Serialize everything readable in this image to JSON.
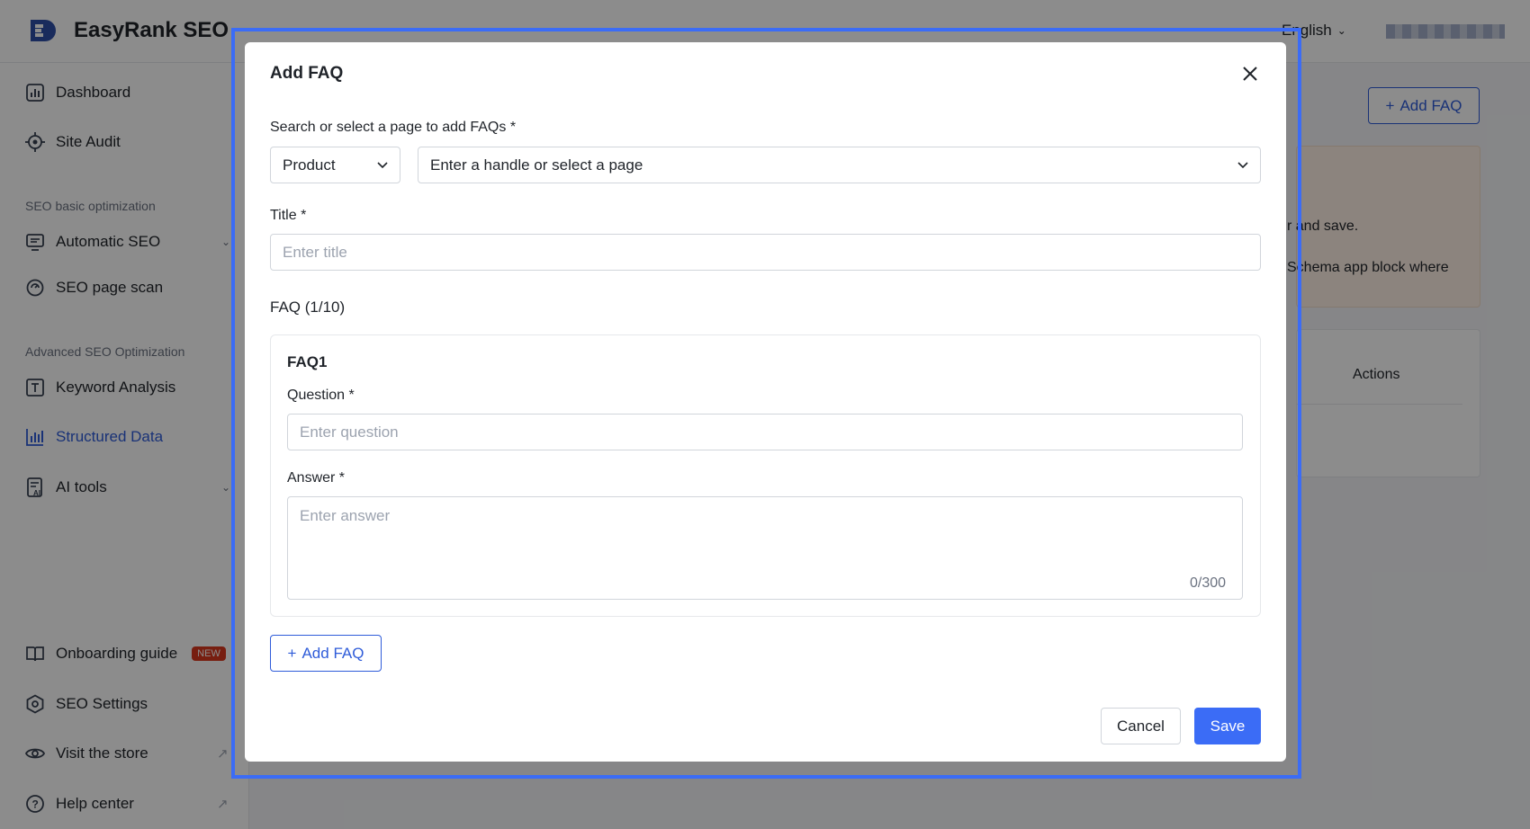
{
  "app": {
    "name": "EasyRank SEO",
    "language": "English",
    "colors": {
      "accent": "#2f5cd9",
      "primary_button": "#3b6cf6",
      "highlight_border": "#3b6cf6",
      "new_badge": "#d9381e"
    }
  },
  "sidebar": {
    "top_items": [
      {
        "label": "Dashboard",
        "icon": "dashboard-icon"
      },
      {
        "label": "Site Audit",
        "icon": "target-icon"
      }
    ],
    "section_basic": "SEO basic optimization",
    "basic_items": [
      {
        "label": "Automatic SEO",
        "icon": "monitor-icon",
        "expandable": true
      },
      {
        "label": "SEO page scan",
        "icon": "scan-icon"
      }
    ],
    "section_advanced": "Advanced SEO Optimization",
    "advanced_items": [
      {
        "label": "Keyword Analysis",
        "icon": "text-box-icon"
      },
      {
        "label": "Structured Data",
        "icon": "chart-bars-icon",
        "active": true
      },
      {
        "label": "AI tools",
        "icon": "ai-doc-icon",
        "expandable": true
      }
    ],
    "bottom_items": [
      {
        "label": "Onboarding guide",
        "icon": "book-icon",
        "badge": "NEW"
      },
      {
        "label": "SEO Settings",
        "icon": "settings-hex-icon"
      },
      {
        "label": "Visit the store",
        "icon": "eye-icon",
        "external": true
      },
      {
        "label": "Help center",
        "icon": "help-circle-icon",
        "external": true
      }
    ]
  },
  "main": {
    "add_faq_button": "Add FAQ",
    "notice_line1": "r and save.",
    "notice_line2": "Schema app block where",
    "table_actions_header": "Actions"
  },
  "modal": {
    "title": "Add FAQ",
    "page_select_label": "Search or select a page to add FAQs *",
    "page_type_value": "Product",
    "page_search_placeholder": "Enter a handle or select a page",
    "title_label": "Title *",
    "title_placeholder": "Enter title",
    "faq_count_label": "FAQ (1/10)",
    "faq_items": [
      {
        "heading": "FAQ1",
        "question_label": "Question *",
        "question_placeholder": "Enter question",
        "answer_label": "Answer *",
        "answer_placeholder": "Enter answer",
        "answer_counter": "0/300"
      }
    ],
    "add_faq_button": "Add FAQ",
    "cancel_button": "Cancel",
    "save_button": "Save"
  }
}
